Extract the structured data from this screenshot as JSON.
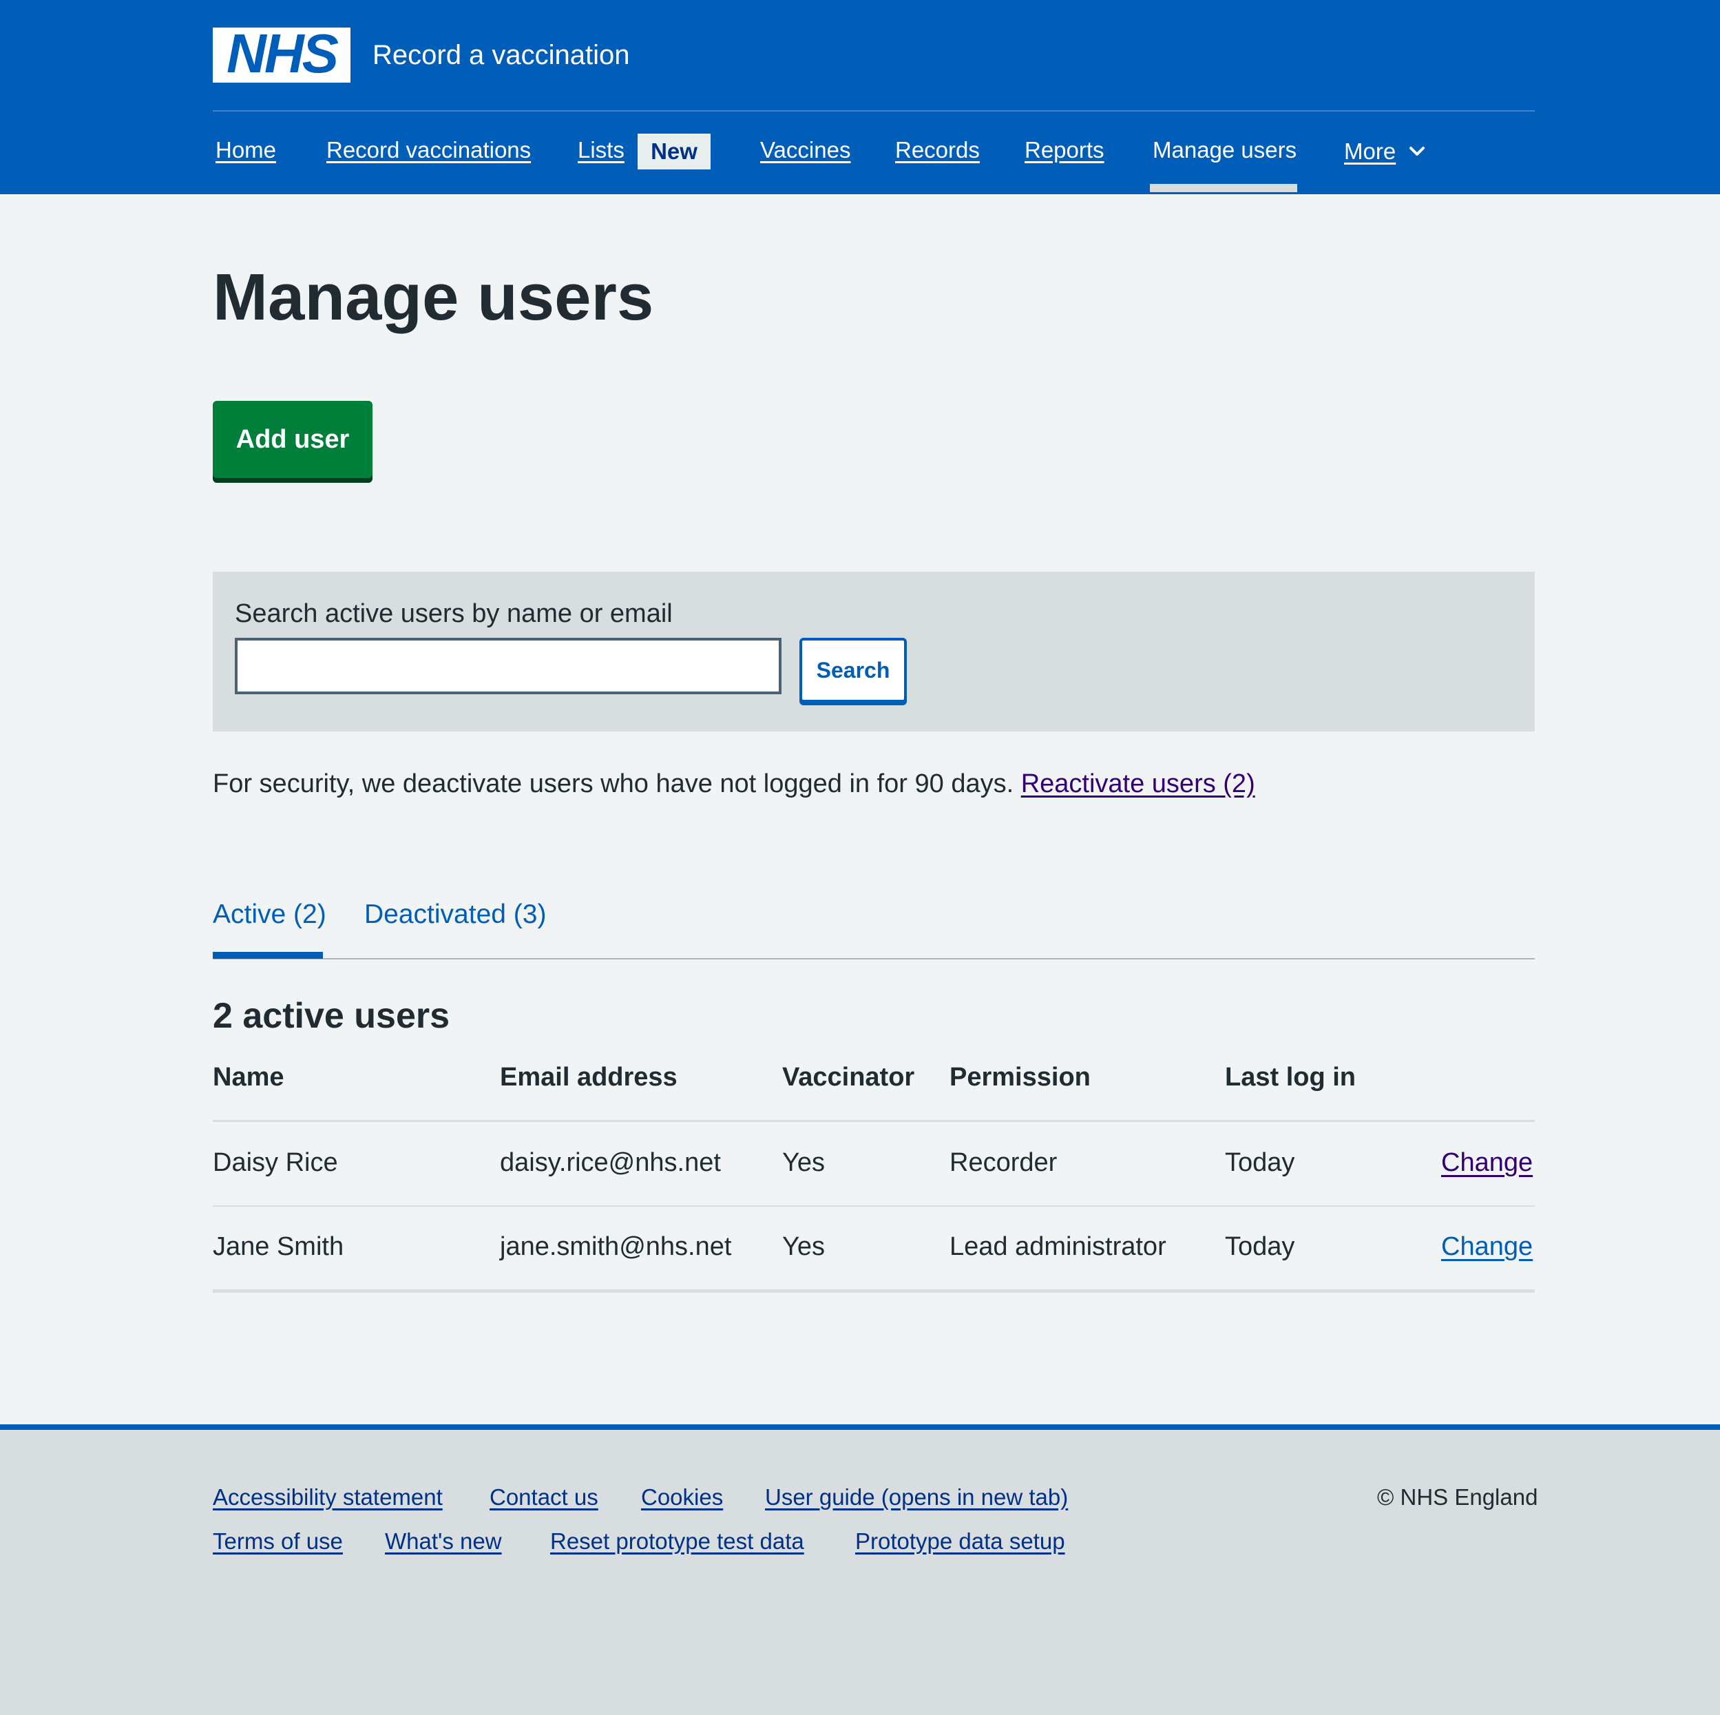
{
  "header": {
    "logo_text": "NHS",
    "service_name": "Record a vaccination",
    "nav": [
      {
        "label": "Home"
      },
      {
        "label": "Record vaccinations"
      },
      {
        "label": "Lists",
        "tag": "New"
      },
      {
        "label": "Vaccines"
      },
      {
        "label": "Records"
      },
      {
        "label": "Reports"
      },
      {
        "label": "Manage users",
        "current": true
      },
      {
        "label": "More",
        "icon": "chevron-down-icon"
      }
    ]
  },
  "main": {
    "title": "Manage users",
    "add_user_label": "Add user",
    "search": {
      "label": "Search active users by name or email",
      "value": "",
      "button_label": "Search"
    },
    "security_notice": "For security, we deactivate users who have not logged in for 90 days.",
    "reactivate_link": "Reactivate users (2)",
    "tabs": [
      {
        "label": "Active (2)",
        "selected": true
      },
      {
        "label": "Deactivated (3)",
        "selected": false
      }
    ],
    "section_heading": "2 active users",
    "table": {
      "headers": [
        "Name",
        "Email address",
        "Vaccinator",
        "Permission",
        "Last log in"
      ],
      "rows": [
        {
          "name": "Daisy Rice",
          "email": "daisy.rice@nhs.net",
          "vaccinator": "Yes",
          "permission": "Recorder",
          "last_login": "Today",
          "action": "Change"
        },
        {
          "name": "Jane Smith",
          "email": "jane.smith@nhs.net",
          "vaccinator": "Yes",
          "permission": "Lead administrator",
          "last_login": "Today",
          "action": "Change"
        }
      ]
    }
  },
  "footer": {
    "links": [
      "Accessibility statement",
      "Contact us",
      "Cookies",
      "User guide (opens in new tab)",
      "Terms of use",
      "What's new",
      "Reset prototype test data",
      "Prototype data setup"
    ],
    "copyright": "© NHS England"
  },
  "colors": {
    "brand_blue": "#005eb8",
    "button_green": "#007f3b",
    "page_background": "#f0f4f5",
    "panel_grey": "#d8dde0",
    "visited_link": "#330072"
  }
}
